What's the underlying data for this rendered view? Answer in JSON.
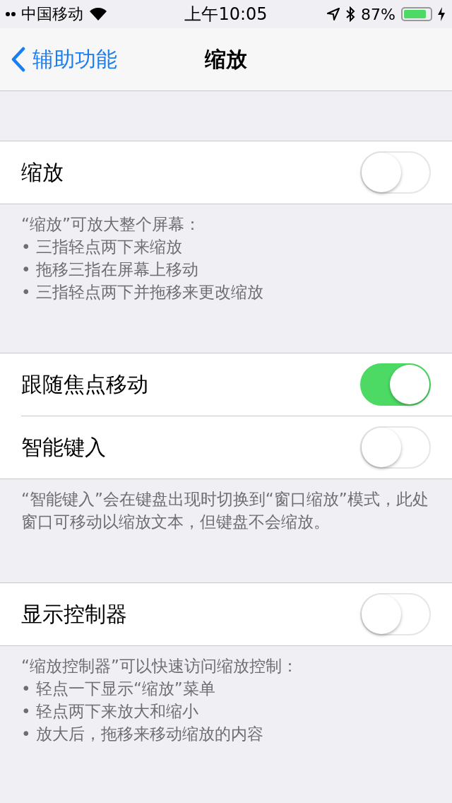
{
  "status_bar": {
    "carrier": "中国移动",
    "time": "上午10:05",
    "battery": "87%"
  },
  "nav": {
    "back": "辅助功能",
    "title": "缩放"
  },
  "sections": [
    {
      "rows": [
        {
          "label": "缩放",
          "on": false
        }
      ],
      "footer": [
        "“缩放”可放大整个屏幕：",
        "•  三指轻点两下来缩放",
        "•  拖移三指在屏幕上移动",
        "•  三指轻点两下并拖移来更改缩放"
      ]
    },
    {
      "rows": [
        {
          "label": "跟随焦点移动",
          "on": true
        },
        {
          "label": "智能键入",
          "on": false
        }
      ],
      "footer": [
        "“智能键入”会在键盘出现时切换到“窗口缩放”模式，此处窗口可移动以缩放文本，但键盘不会缩放。"
      ]
    },
    {
      "rows": [
        {
          "label": "显示控制器",
          "on": false
        }
      ],
      "footer": [
        "“缩放控制器”可以快速访问缩放控制：",
        "• 轻点一下显示“缩放”菜单",
        "• 轻点两下来放大和缩小",
        "• 放大后，拖移来移动缩放的内容"
      ]
    }
  ]
}
